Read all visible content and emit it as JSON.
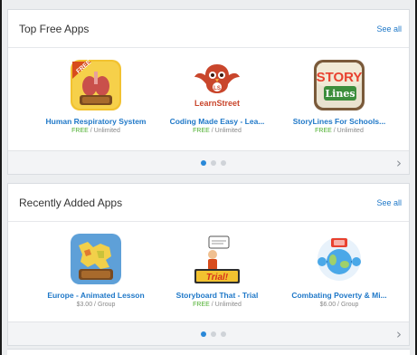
{
  "sections": [
    {
      "title": "Top Free Apps",
      "see_all": "See all",
      "apps": [
        {
          "name": "Human Respiratory System",
          "price": "FREE",
          "license": "Unlimited",
          "icon": "respiratory-icon"
        },
        {
          "name": "Coding Made Easy - Lea...",
          "price": "FREE",
          "license": "Unlimited",
          "icon": "learnstreet-icon",
          "icon_text": "LearnStreet"
        },
        {
          "name": "StoryLines For Schools...",
          "price": "FREE",
          "license": "Unlimited",
          "icon": "storylines-icon",
          "icon_text_1": "STORY",
          "icon_text_2": "Lines"
        }
      ]
    },
    {
      "title": "Recently Added Apps",
      "see_all": "See all",
      "apps": [
        {
          "name": "Europe - Animated Lesson",
          "price": "$3.00",
          "license": "Group",
          "icon": "europe-map-icon"
        },
        {
          "name": "Storyboard That - Trial",
          "price": "FREE",
          "license": "Unlimited",
          "icon": "storyboard-icon",
          "icon_text": "Trial!"
        },
        {
          "name": "Combating Poverty & Mi...",
          "price": "$6.00",
          "license": "Group",
          "icon": "poverty-icon"
        }
      ]
    }
  ],
  "pagination": {
    "pages": 3,
    "active": 1
  },
  "colors": {
    "link": "#1f78c8",
    "free": "#4caf2d",
    "dot_active": "#2a88d8"
  }
}
